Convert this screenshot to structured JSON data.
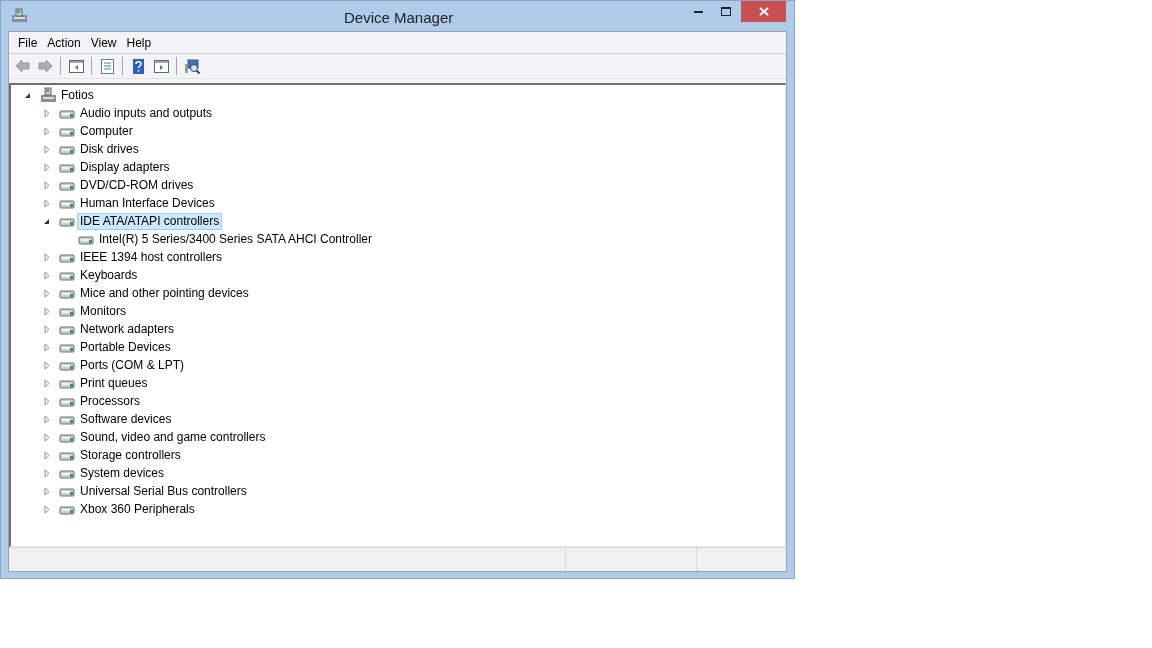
{
  "window": {
    "title": "Device Manager"
  },
  "menu": [
    {
      "label": "File"
    },
    {
      "label": "Action"
    },
    {
      "label": "View"
    },
    {
      "label": "Help"
    }
  ],
  "toolbar": [
    {
      "kind": "back",
      "disabled": true
    },
    {
      "kind": "forward",
      "disabled": true
    },
    {
      "kind": "separator"
    },
    {
      "kind": "console-tree"
    },
    {
      "kind": "separator"
    },
    {
      "kind": "properties"
    },
    {
      "kind": "separator"
    },
    {
      "kind": "help"
    },
    {
      "kind": "action-pane"
    },
    {
      "kind": "separator"
    },
    {
      "kind": "scan"
    }
  ],
  "tree": [
    {
      "label": "Fotios",
      "expanded": true,
      "selected": false,
      "children": [
        {
          "label": "Audio inputs and outputs",
          "expanded": false,
          "selected": false
        },
        {
          "label": "Computer",
          "expanded": false,
          "selected": false
        },
        {
          "label": "Disk drives",
          "expanded": false,
          "selected": false
        },
        {
          "label": "Display adapters",
          "expanded": false,
          "selected": false
        },
        {
          "label": "DVD/CD-ROM drives",
          "expanded": false,
          "selected": false
        },
        {
          "label": "Human Interface Devices",
          "expanded": false,
          "selected": false
        },
        {
          "label": "IDE ATA/ATAPI controllers",
          "expanded": true,
          "selected": true,
          "children": [
            {
              "label": "Intel(R) 5 Series/3400 Series SATA AHCI Controller",
              "selected": false
            }
          ]
        },
        {
          "label": "IEEE 1394 host controllers",
          "expanded": false,
          "selected": false
        },
        {
          "label": "Keyboards",
          "expanded": false,
          "selected": false
        },
        {
          "label": "Mice and other pointing devices",
          "expanded": false,
          "selected": false
        },
        {
          "label": "Monitors",
          "expanded": false,
          "selected": false
        },
        {
          "label": "Network adapters",
          "expanded": false,
          "selected": false
        },
        {
          "label": "Portable Devices",
          "expanded": false,
          "selected": false
        },
        {
          "label": "Ports (COM & LPT)",
          "expanded": false,
          "selected": false
        },
        {
          "label": "Print queues",
          "expanded": false,
          "selected": false
        },
        {
          "label": "Processors",
          "expanded": false,
          "selected": false
        },
        {
          "label": "Software devices",
          "expanded": false,
          "selected": false
        },
        {
          "label": "Sound, video and game controllers",
          "expanded": false,
          "selected": false
        },
        {
          "label": "Storage controllers",
          "expanded": false,
          "selected": false
        },
        {
          "label": "System devices",
          "expanded": false,
          "selected": false
        },
        {
          "label": "Universal Serial Bus controllers",
          "expanded": false,
          "selected": false
        },
        {
          "label": "Xbox 360 Peripherals",
          "expanded": false,
          "selected": false
        }
      ]
    }
  ]
}
